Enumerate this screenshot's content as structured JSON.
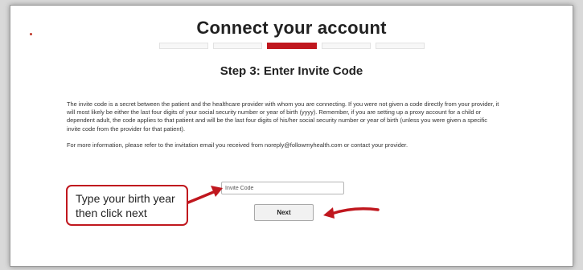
{
  "page": {
    "title": "Connect your account",
    "step_title": "Step 3: Enter Invite Code",
    "progress": {
      "total_steps": 5,
      "current_step": 3
    }
  },
  "content": {
    "paragraph1": "The invite code is a secret between the patient and the healthcare provider with whom you are connecting.  If you were not given a code directly from your provider, it will most likely be either the last four digits of your social security number or year of birth (yyyy).  Remember, if you are setting up a proxy account for a child or dependent adult, the code applies to that patient and will be the last four digits of his/her social security number or year of birth (unless you were given a specific invite code from the provider for that patient).",
    "paragraph2": "For more information, please refer to the invitation email you received from noreply@followmyhealth.com or contact your provider."
  },
  "form": {
    "invite_placeholder": "Invite Code",
    "invite_value": "",
    "next_label": "Next"
  },
  "annotation": {
    "callout_line1": "Type your birth year",
    "callout_line2": "then click next",
    "arrow_color": "#c0171e"
  },
  "colors": {
    "accent": "#c0171e",
    "background": "#d9d9d9",
    "panel": "#ffffff"
  }
}
